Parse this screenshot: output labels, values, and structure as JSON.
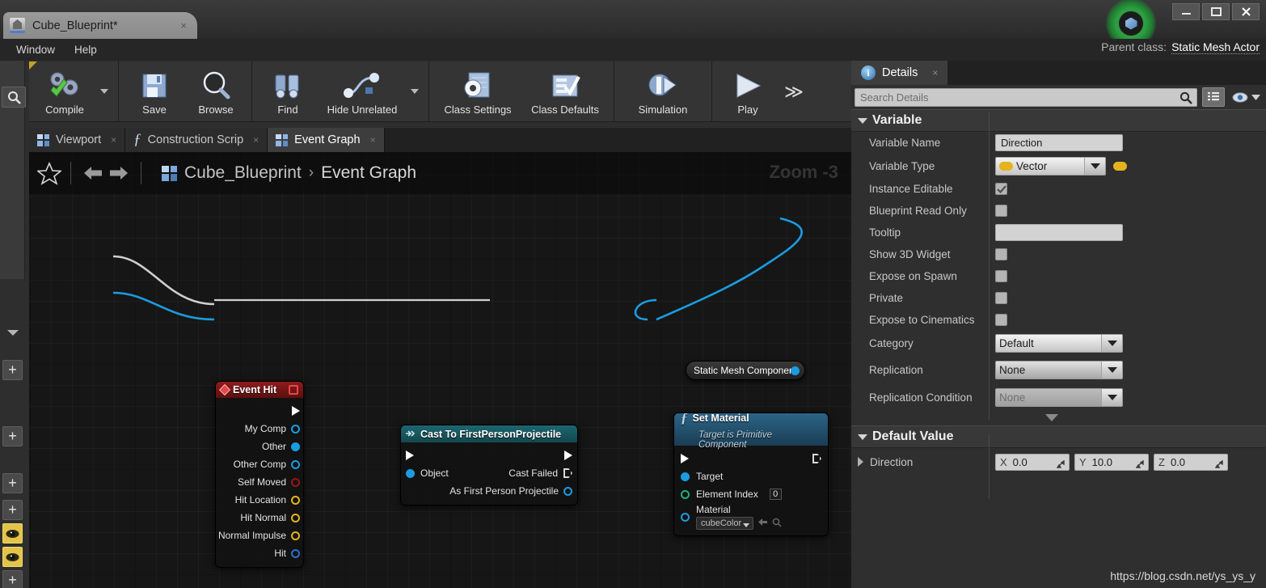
{
  "window": {
    "tab_title": "Cube_Blueprint*",
    "tab_close": "×",
    "minimize_icon": "minimize-icon",
    "maximize_icon": "maximize-icon",
    "close_icon": "close-icon",
    "logo_icon": "unreal-engine-logo-icon"
  },
  "menubar": {
    "items": [
      {
        "label": "Window"
      },
      {
        "label": "Help"
      }
    ]
  },
  "parent_class": {
    "label": "Parent class:",
    "value": "Static Mesh Actor"
  },
  "toolbar": {
    "groups": [
      {
        "buttons": [
          {
            "label": "Compile",
            "icon": "compile-gears-check-icon",
            "has_dropdown": true
          }
        ]
      },
      {
        "buttons": [
          {
            "label": "Save",
            "icon": "floppy-disk-icon"
          },
          {
            "label": "Browse",
            "icon": "magnifier-browse-icon"
          }
        ]
      },
      {
        "buttons": [
          {
            "label": "Find",
            "icon": "binoculars-icon"
          },
          {
            "label": "Hide Unrelated",
            "icon": "node-graph-icon",
            "has_dropdown": true
          }
        ]
      },
      {
        "buttons": [
          {
            "label": "Class Settings",
            "icon": "class-settings-gear-icon"
          },
          {
            "label": "Class Defaults",
            "icon": "class-defaults-checklist-icon"
          }
        ]
      },
      {
        "buttons": [
          {
            "label": "Simulation",
            "icon": "simulation-gear-play-icon"
          }
        ]
      },
      {
        "buttons": [
          {
            "label": "Play",
            "icon": "play-triangle-icon"
          }
        ]
      }
    ],
    "overflow_label": "≫"
  },
  "graph_tabs": [
    {
      "label": "Viewport",
      "icon": "blueprint-grid-icon",
      "active": false,
      "close": "×"
    },
    {
      "label": "Construction Scrip",
      "icon": "function-fx-icon",
      "active": false,
      "close": "×"
    },
    {
      "label": "Event Graph",
      "icon": "blueprint-grid-icon",
      "active": true,
      "close": "×"
    }
  ],
  "graph_header": {
    "favorite_icon": "star-icon",
    "back_icon": "arrow-left-icon",
    "forward_icon": "arrow-right-icon",
    "breadcrumb_icon": "blueprint-grid-icon",
    "breadcrumb_root": "Cube_Blueprint",
    "breadcrumb_sep": "›",
    "breadcrumb_leaf": "Event Graph",
    "zoom_label": "Zoom -3"
  },
  "nodes": {
    "event_hit": {
      "title": "Event Hit",
      "title_icon": "event-diamond-icon",
      "delegate_icon": "delegate-pin-icon",
      "exec_out": "",
      "outputs": [
        {
          "label": "My Comp",
          "pin": "object-ring-blue"
        },
        {
          "label": "Other",
          "pin": "object-dot-blue"
        },
        {
          "label": "Other Comp",
          "pin": "object-ring-blue"
        },
        {
          "label": "Self Moved",
          "pin": "bool-ring-red"
        },
        {
          "label": "Hit Location",
          "pin": "vector-ring-yellow"
        },
        {
          "label": "Hit Normal",
          "pin": "vector-ring-yellow"
        },
        {
          "label": "Normal Impulse",
          "pin": "vector-ring-yellow"
        },
        {
          "label": "Hit",
          "pin": "struct-ring-blue"
        }
      ]
    },
    "cast": {
      "title": "Cast To FirstPersonProjectile",
      "title_icon": "cast-arrow-icon",
      "input_object": "Object",
      "out_cast_failed": "Cast Failed",
      "out_as_projectile": "As First Person Projectile"
    },
    "static_mesh_component": {
      "title": "Static Mesh Component"
    },
    "set_material": {
      "title": "Set Material",
      "title_icon": "function-fx-icon",
      "subtitle": "Target is Primitive Component",
      "rows": [
        {
          "label": "Target",
          "pin": "object-dot-blue"
        },
        {
          "label": "Element Index",
          "pin": "int-ring-green",
          "value": "0"
        },
        {
          "label": "Material",
          "pin": "object-ring-blue",
          "value": "cubeColor"
        }
      ]
    }
  },
  "left_rail": {
    "search_icon": "magnifier-icon",
    "dropdown_icon": "chevron-down-icon",
    "buttons": [
      {
        "icon": "plus-icon"
      },
      {
        "icon": "plus-icon"
      },
      {
        "icon": "plus-icon"
      },
      {
        "icon": "plus-icon"
      },
      {
        "icon": "eye-icon"
      },
      {
        "icon": "eye-icon"
      },
      {
        "icon": "plus-icon"
      }
    ]
  },
  "details": {
    "tab_label": "Details",
    "tab_icon": "info-icon",
    "tab_close": "×",
    "search": {
      "placeholder": "Search Details",
      "icon": "magnifier-icon"
    },
    "grid_button_icon": "grid-view-icon",
    "eye_button_icon": "eye-icon",
    "eye_caret_icon": "chevron-down-icon",
    "sections": [
      {
        "title": "Variable",
        "properties": [
          {
            "label": "Variable Name",
            "type": "text",
            "value": "Direction"
          },
          {
            "label": "Variable Type",
            "type": "combo-type",
            "value": "Vector",
            "swatch": "#e5b31e"
          },
          {
            "label": "Instance Editable",
            "type": "checkbox",
            "checked": true
          },
          {
            "label": "Blueprint Read Only",
            "type": "checkbox",
            "checked": false
          },
          {
            "label": "Tooltip",
            "type": "text",
            "value": ""
          },
          {
            "label": "Show 3D Widget",
            "type": "checkbox",
            "checked": false
          },
          {
            "label": "Expose on Spawn",
            "type": "checkbox",
            "checked": false
          },
          {
            "label": "Private",
            "type": "checkbox",
            "checked": false
          },
          {
            "label": "Expose to Cinematics",
            "type": "checkbox",
            "checked": false
          },
          {
            "label": "Category",
            "type": "combo",
            "value": "Default"
          },
          {
            "label": "Replication",
            "type": "combo",
            "value": "None"
          },
          {
            "label": "Replication Condition",
            "type": "combo-disabled",
            "value": "None"
          }
        ]
      },
      {
        "title": "Default Value",
        "properties": [
          {
            "label": "Direction",
            "type": "vector",
            "axes": [
              {
                "axis": "X",
                "value": "0.0"
              },
              {
                "axis": "Y",
                "value": "10.0"
              },
              {
                "axis": "Z",
                "value": "0.0"
              }
            ]
          }
        ]
      }
    ],
    "collapse_icon": "chevron-down-icon"
  },
  "watermark": "https://blog.csdn.net/ys_ys_y"
}
